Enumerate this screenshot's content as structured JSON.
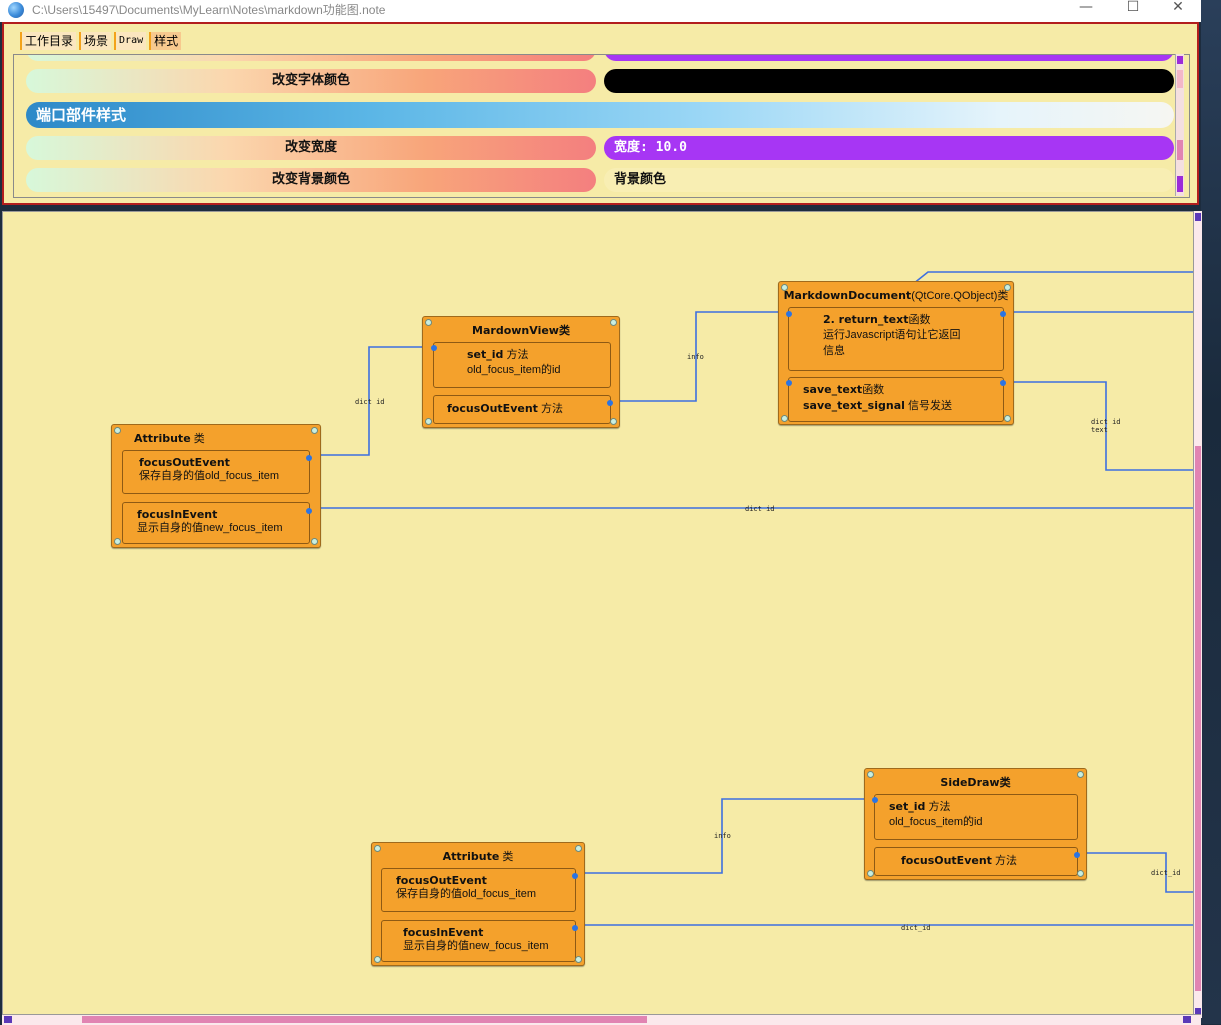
{
  "window": {
    "title": "C:\\Users\\15497\\Documents\\MyLearn\\Notes\\markdown功能图.note",
    "minimize_label": "—",
    "maximize_label": "☐",
    "close_label": "✕"
  },
  "tabs": [
    {
      "label": "工作目录"
    },
    {
      "label": "场景"
    },
    {
      "label": "Draw"
    },
    {
      "label": "样式"
    }
  ],
  "style_panel": {
    "rows": [
      {
        "label": "改变字体颜色",
        "value": "",
        "color": "#000000"
      },
      {
        "label": "改变宽度",
        "value": "宽度: 10.0",
        "color": "#a736f4"
      },
      {
        "label": "改变背景颜色",
        "value": "背景颜色",
        "color": "#f8eeb3"
      }
    ],
    "section_header": "端口部件样式",
    "accent_colors": {
      "purple": "#a736f4",
      "blue": "#2d89c8",
      "orange": "#f4a12c",
      "edge": "#3d6fe0"
    }
  },
  "diagram": {
    "nodes": {
      "attr1": {
        "title_b": "Attribute",
        "title_n": " 类",
        "slots": [
          {
            "b": "focusOutEvent",
            "n": "保存自身的值old_focus_item"
          },
          {
            "b": "focusInEvent",
            "n": "显示自身的值new_focus_item"
          }
        ]
      },
      "mview": {
        "title_b": "MardownView类",
        "slots": [
          {
            "b": "set_id",
            "n": " 方法",
            "n2": "old_focus_item的id"
          },
          {
            "b": "focusOutEvent",
            "n": " 方法"
          }
        ]
      },
      "mdoc": {
        "title_b": "MarkdownDocument",
        "title_n": "(QtCore.QObject)类",
        "slots": [
          {
            "b": "2. return_text",
            "n": "函数",
            "n2": "运行Javascript语句让它返回",
            "n3": "信息"
          },
          {
            "b": "save_text",
            "n": "函数",
            "b2": "save_text_signal",
            "n4": " 信号发送"
          }
        ]
      },
      "sidedraw": {
        "title_b": "SideDraw类",
        "slots": [
          {
            "b": "set_id",
            "n": " 方法",
            "n2": "old_focus_item的id"
          },
          {
            "b": "focusOutEvent",
            "n": " 方法"
          }
        ]
      },
      "attr2": {
        "title_b": "Attribute",
        "title_n": " 类",
        "slots": [
          {
            "b": "focusOutEvent",
            "n": "保存自身的值old_focus_item"
          },
          {
            "b": "focusInEvent",
            "n": "显示自身的值new_focus_item"
          }
        ]
      }
    },
    "edge_labels": {
      "e1": "dict id",
      "e2": "info",
      "e3a": "dict id",
      "e3b": "text",
      "e4": "dict id",
      "e5": "info",
      "e6": "dict_id",
      "e7": "dict_id"
    }
  }
}
